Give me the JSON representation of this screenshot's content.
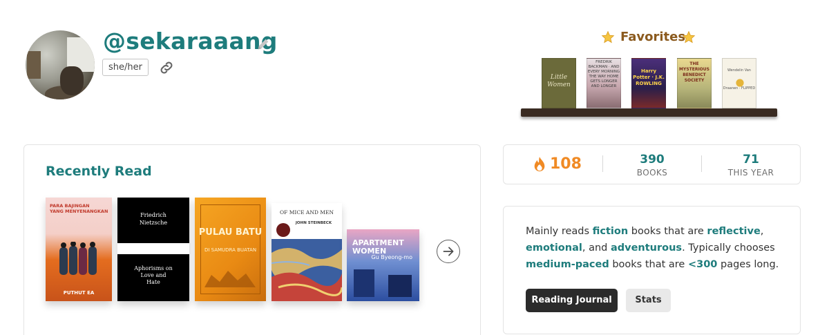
{
  "profile": {
    "username": "@sekaraaang",
    "pronouns": "she/her"
  },
  "icons": {
    "edit": "pencil-icon",
    "link": "link-icon",
    "star": "star-icon",
    "fire": "fire-icon",
    "next": "arrow-right-circle-icon"
  },
  "favorites": {
    "title": "Favorites",
    "books": [
      {
        "cover_text": "Little Women",
        "color": "#6b6a3a"
      },
      {
        "cover_text": "FREDRIK BACKMAN · AND EVERY MORNING THE WAY HOME GETS LONGER AND LONGER",
        "color": "#b98f9a"
      },
      {
        "cover_text": "Harry Potter · J.K. ROWLING",
        "color": "#3b2a5e"
      },
      {
        "cover_text": "THE MYSTERIOUS BENEDICT SOCIETY",
        "color": "#d7c27a"
      },
      {
        "cover_text": "Wendelin Van Draanen · FLIPPED",
        "color": "#f6f2e6"
      }
    ]
  },
  "recently_read": {
    "title": "Recently Read",
    "books": [
      {
        "title_line1": "PARA BAJINGAN",
        "title_line2": "YANG MENYENANGKAN",
        "author": "PUTHUT EA"
      },
      {
        "title_top": "Friedrich Nietzsche",
        "title_bottom": "Aphorisms on Love and Hate"
      },
      {
        "title": "PULAU BATU",
        "subtitle": "DI SAMUDRA BUATAN"
      },
      {
        "title": "OF MICE AND MEN",
        "author": "JOHN STEINBECK"
      },
      {
        "title": "APARTMENT WOMEN",
        "author": "Gu Byeong-mo"
      }
    ]
  },
  "stats": {
    "streak": "108",
    "books_count": "390",
    "books_label": "BOOKS",
    "year_count": "71",
    "year_label": "THIS YEAR"
  },
  "summary": {
    "p1": "Mainly reads ",
    "g1": "fiction",
    "p2": " books that are ",
    "m1": "reflective",
    "p3": ",",
    "m2": "emotional",
    "p4": ", and ",
    "m3": "adventurous",
    "p5": ". Typically chooses",
    "pace": "medium-paced",
    "p6": " books that are ",
    "pages": "<300",
    "p7": " pages long."
  },
  "buttons": {
    "journal": "Reading Journal",
    "stats": "Stats"
  },
  "colors": {
    "accent": "#1e7c7c",
    "streak": "#f08a24",
    "shelf": "#3a2b22"
  }
}
